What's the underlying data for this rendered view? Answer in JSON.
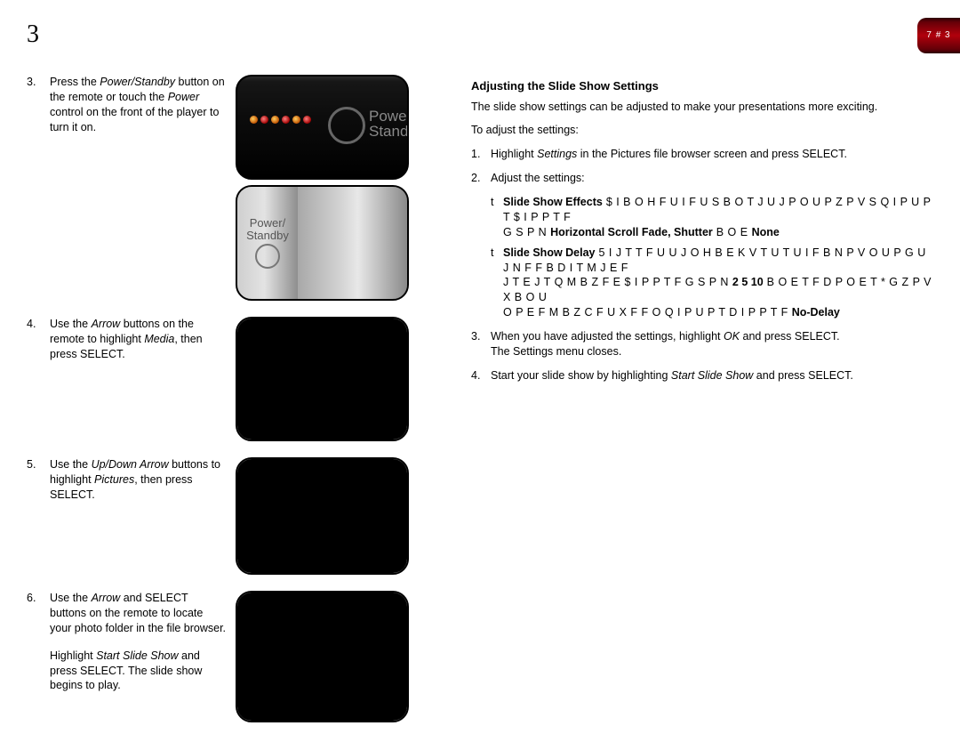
{
  "chrome": {
    "page_ornament": "3",
    "corner_tab": "7 # 3"
  },
  "left": {
    "step3": {
      "num": "3.",
      "text_a": "Press the ",
      "power_standby": "Power/Standby",
      "text_b": " button on the remote or touch the ",
      "power": "Power",
      "text_c": " control on the front of the player to turn it on."
    },
    "device_label_a": "Power/",
    "device_label_b": "Standby",
    "ui_label_power": "Power/",
    "ui_label_standby": "Standby",
    "step4": {
      "num": "4.",
      "text_a": "Use the ",
      "arrow": "Arrow",
      "text_b": " buttons on the remote to highlight ",
      "media": "Media",
      "text_c": ", then press ",
      "select": "SELECT",
      "text_d": "."
    },
    "step5": {
      "num": "5.",
      "text_a": "Use the ",
      "updown": "Up/Down Arrow",
      "text_b": " buttons to highlight ",
      "pictures": "Pictures",
      "text_c": ", then press ",
      "select": "SELECT",
      "text_d": "."
    },
    "step6": {
      "num": "6.",
      "text_a": "Use the ",
      "arrow": "Arrow",
      "text_b": " and ",
      "select": "SELECT",
      "text_c": " buttons on the remote to locate your photo folder in the file browser.",
      "para2_a": "Highlight ",
      "start_slide": "Start Slide Show",
      "para2_b": " and press ",
      "select2": "SELECT",
      "para2_c": ". The slide show begins to play."
    }
  },
  "right": {
    "heading": "Adjusting the Slide Show Settings",
    "intro": "The slide show settings can be adjusted to make your presentations more exciting.",
    "lead": "To adjust the settings:",
    "s1": {
      "num": "1.",
      "a": "Highlight ",
      "settings": "Settings",
      "b": " in the Pictures file browser screen and press ",
      "select": "SELECT",
      "c": "."
    },
    "s2": {
      "num": "2.",
      "text": "Adjust the settings:"
    },
    "b1": {
      "dot": "t",
      "label": "Slide Show Effects",
      "g1": "  $ I B O H F U I F  U S B O T J U J P O  U P  Z P V S  Q I P U P T   $ I P P T F",
      "line2a": "G S P N ",
      "hscroll": "Horizontal Scroll",
      "line2b": "    Fade, Shutter",
      "line2c": "    B O E ",
      "none": "None"
    },
    "b2": {
      "dot": "t",
      "label": "Slide Show Delay",
      "g1": " 5 I J T  T F U U J O H  B E K V T U T  U I F  B N P V O U  P G  U J N F  F B D I  T M J E F",
      "g2": "J T  E J T Q M B Z F E   $ I P P T F  G S P N ",
      "n25": "2  5  10",
      "g2b": "    B O E    T F D P O E T   * G  Z P V  X B O U",
      "g3": "O P  E F M B Z  C F U X F F O  Q I P U P T   D I P P T F ",
      "nodelay": "No-Delay"
    },
    "s3": {
      "num": "3.",
      "a": "When you have adjusted the settings, highlight ",
      "ok": "OK",
      "b": " and press ",
      "select": "SELECT",
      "c": ".",
      "d": "The Settings menu closes."
    },
    "s4": {
      "num": "4.",
      "a": "Start your slide show by highlighting ",
      "start": "Start Slide Show",
      "b": " and press ",
      "select": "SELECT",
      "c": "."
    }
  }
}
